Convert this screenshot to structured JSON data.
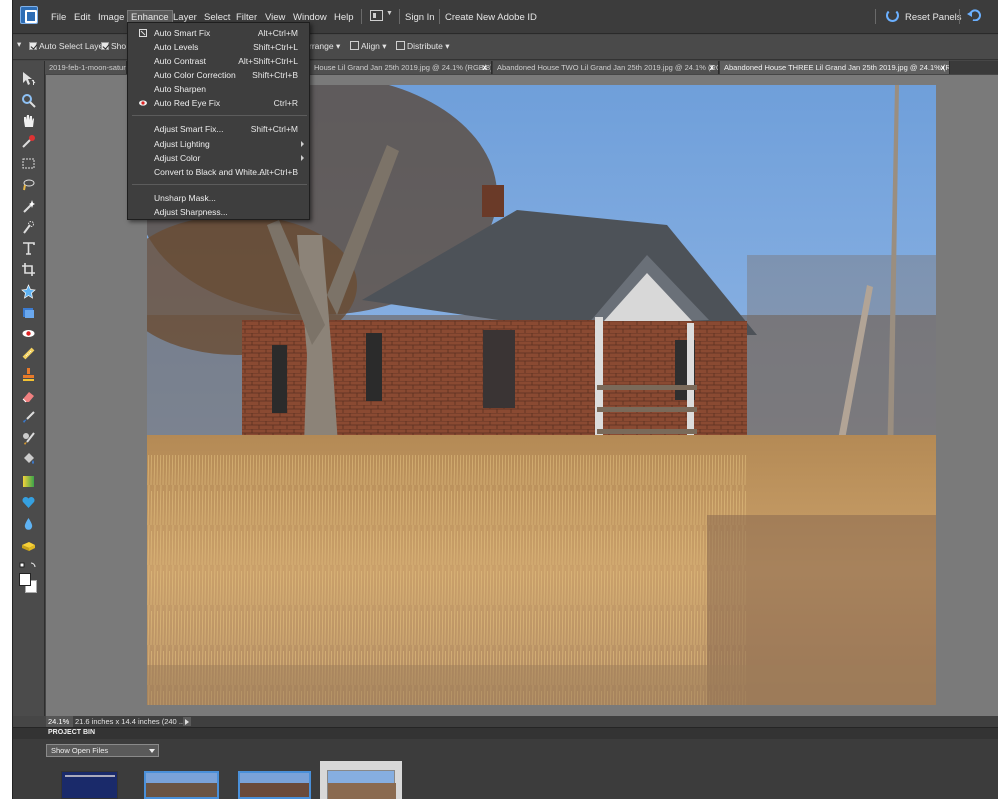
{
  "menubar": {
    "items": [
      "File",
      "Edit",
      "Image",
      "Enhance",
      "Layer",
      "Select",
      "Filter",
      "View",
      "Window",
      "Help"
    ],
    "sign_in": "Sign In",
    "create_id": "Create New Adobe ID",
    "reset_panels": "Reset Panels",
    "undo_label": "Undo"
  },
  "options": {
    "auto_select_layer": "Auto Select Layer",
    "show_partial": "Sho",
    "arrange": "rrange",
    "align": "Align",
    "distribute": "Distribute"
  },
  "tabs": [
    "2019-feb-1-moon-saturn-",
    "House Lil Grand Jan 25th 2019.jpg @ 24.1% (RGB/8)",
    "Abandoned House TWO Lil Grand Jan 25th 2019.jpg @ 24.1% (RGB/8)",
    "Abandoned House THREE Lil Grand Jan 25th 2019.jpg @ 24.1% (RGB/8)"
  ],
  "tab_close": "x",
  "enhance_menu": [
    {
      "label": "Auto Smart Fix",
      "shortcut": "Alt+Ctrl+M",
      "icon": "auto-smart-fix-icon"
    },
    {
      "label": "Auto Levels",
      "shortcut": "Shift+Ctrl+L"
    },
    {
      "label": "Auto Contrast",
      "shortcut": "Alt+Shift+Ctrl+L"
    },
    {
      "label": "Auto Color Correction",
      "shortcut": "Shift+Ctrl+B"
    },
    {
      "label": "Auto Sharpen",
      "shortcut": ""
    },
    {
      "label": "Auto Red Eye Fix",
      "shortcut": "Ctrl+R",
      "icon": "red-eye-icon"
    },
    {
      "label": "Adjust Smart Fix...",
      "shortcut": "Shift+Ctrl+M"
    },
    {
      "label": "Adjust Lighting",
      "shortcut": "",
      "submenu": true
    },
    {
      "label": "Adjust Color",
      "shortcut": "",
      "submenu": true
    },
    {
      "label": "Convert to Black and White...",
      "shortcut": "Alt+Ctrl+B"
    },
    {
      "label": "Unsharp Mask...",
      "shortcut": ""
    },
    {
      "label": "Adjust Sharpness...",
      "shortcut": ""
    }
  ],
  "status": {
    "zoom": "24.1%",
    "doc_size": "21.6 inches x 14.4 inches (240 ..."
  },
  "project_bin": {
    "title": "PROJECT BIN",
    "selector": "Show Open Files"
  },
  "colors": {
    "accent_blue": "#6bb0ff",
    "thumb_border": "#4a90d9",
    "sky": "#7aa9e0"
  },
  "tools": [
    "move-tool-icon",
    "zoom-tool-icon",
    "hand-tool-icon",
    "eyedropper-tool-icon",
    "marquee-tool-icon",
    "lasso-tool-icon",
    "magic-wand-tool-icon",
    "quick-selection-tool-icon",
    "type-tool-icon",
    "crop-tool-icon",
    "cookie-cutter-tool-icon",
    "straighten-tool-icon",
    "red-eye-tool-icon",
    "spot-healing-tool-icon",
    "clone-stamp-tool-icon",
    "eraser-tool-icon",
    "brush-tool-icon",
    "smart-brush-tool-icon",
    "paint-bucket-tool-icon",
    "gradient-tool-icon",
    "custom-shape-tool-icon",
    "blur-tool-icon",
    "sponge-tool-icon",
    "swap-colors-icon",
    "color-swatches-icon"
  ]
}
